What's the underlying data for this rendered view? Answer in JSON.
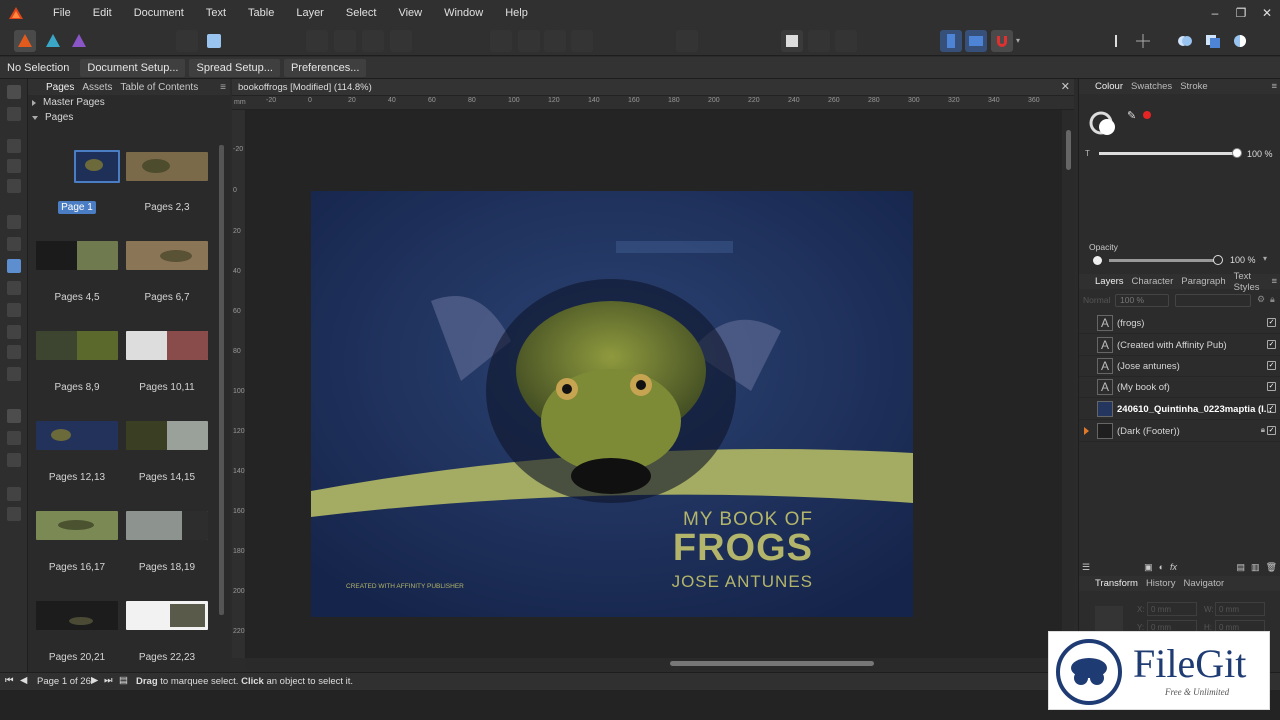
{
  "menubar": {
    "items": [
      "File",
      "Edit",
      "Document",
      "Text",
      "Table",
      "Layer",
      "Select",
      "View",
      "Window",
      "Help"
    ],
    "controls": [
      "–",
      "❐",
      "✕"
    ]
  },
  "context": {
    "selection": "No Selection",
    "buttons": [
      "Document Setup...",
      "Spread Setup...",
      "Preferences..."
    ]
  },
  "pages_panel": {
    "tabs": [
      "Pages",
      "Assets",
      "Table of Contents"
    ],
    "master_pages": "Master Pages",
    "pages": "Pages",
    "page_labels": [
      "Page 1",
      "Pages 2,3",
      "Pages 4,5",
      "Pages 6,7",
      "Pages 8,9",
      "Pages 10,11",
      "Pages 12,13",
      "Pages 14,15",
      "Pages 16,17",
      "Pages 18,19",
      "Pages 20,21",
      "Pages 22,23"
    ]
  },
  "document": {
    "tab_title": "bookoffrogs [Modified] (114.8%)",
    "ruler_unit": "mm",
    "h_ruler": [
      "-20",
      "0",
      "20",
      "40",
      "60",
      "80",
      "100",
      "120",
      "140",
      "160",
      "180",
      "200",
      "220",
      "240",
      "260",
      "280",
      "300",
      "320",
      "340",
      "360"
    ],
    "v_ruler": [
      "-20",
      "0",
      "20",
      "40",
      "60",
      "80",
      "100",
      "120",
      "140",
      "160",
      "180",
      "200",
      "220"
    ]
  },
  "cover": {
    "line1": "MY BOOK OF",
    "line2": "FROGS",
    "line3": "JOSE ANTUNES",
    "credit": "CREATED WITH AFFINITY PUBLISHER",
    "accent": "#b3b56a",
    "bg": "#1d2f52"
  },
  "colour_panel": {
    "tabs": [
      "Colour",
      "Swatches",
      "Stroke"
    ],
    "tint_label": "T",
    "tint_value": "100 %",
    "opacity_label": "Opacity",
    "opacity_value": "100 %"
  },
  "layers_panel": {
    "tabs": [
      "Layers",
      "Character",
      "Paragraph",
      "Text Styles"
    ],
    "blend_label": "Normal",
    "opacity": "100 %",
    "layers": [
      {
        "name": "(frogs)",
        "icon": "text"
      },
      {
        "name": "(Created with Affinity Pub)",
        "icon": "text"
      },
      {
        "name": "(Jose antunes)",
        "icon": "text"
      },
      {
        "name": "(My book of)",
        "icon": "text"
      },
      {
        "name": "240610_Quintinha_0223maptia (I...",
        "icon": "image"
      },
      {
        "name": "(Dark (Footer))",
        "icon": "group"
      }
    ]
  },
  "transform_panel": {
    "tabs": [
      "Transform",
      "History",
      "Navigator"
    ],
    "x_label": "X:",
    "y_label": "Y:",
    "w_label": "W:",
    "h_label": "H:",
    "x": "0 mm",
    "y": "0 mm",
    "w": "0 mm",
    "h": "0 mm"
  },
  "status": {
    "page": "Page 1 of 26",
    "hint_bold1": "Drag",
    "hint1": " to marquee select. ",
    "hint_bold2": "Click",
    "hint2": " an object to select it."
  },
  "watermark": {
    "title": "FileGit",
    "subtitle": "Free & Unlimited"
  }
}
